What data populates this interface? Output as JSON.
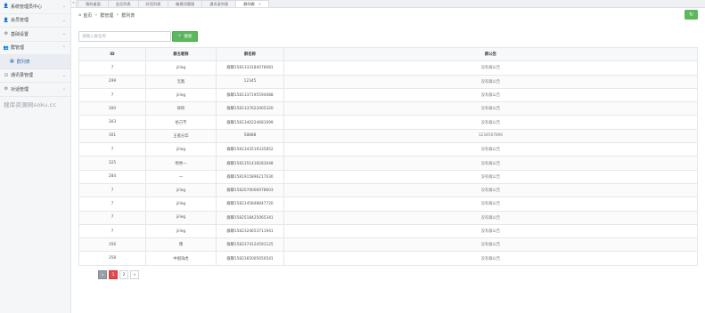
{
  "sidebar": {
    "items": [
      {
        "icon": "user-icon",
        "glyph": "👤",
        "label": "系统管理员中心",
        "chev": "⌄"
      },
      {
        "icon": "user-icon",
        "glyph": "👤",
        "label": "会员管理",
        "chev": "⌄"
      },
      {
        "icon": "gear-icon",
        "glyph": "⚙",
        "label": "基础设置",
        "chev": "⌄"
      },
      {
        "icon": "group-icon",
        "glyph": "👥",
        "label": "群管理",
        "chev": "⌃"
      }
    ],
    "active_sub": {
      "glyph": "▦",
      "label": "群列表"
    },
    "items_after": [
      {
        "icon": "checkbox-icon",
        "glyph": "☑",
        "label": "通讯录管理",
        "chev": "⌄"
      },
      {
        "icon": "gear-icon",
        "glyph": "⚙",
        "label": "对话管理",
        "chev": "⌄"
      }
    ],
    "watermark": "搜库资源网soku.cc"
  },
  "tabs": [
    {
      "label": "我的桌面",
      "active": false
    },
    {
      "label": "会员列表",
      "active": false
    },
    {
      "label": "好话列表",
      "active": false
    },
    {
      "label": "敏感词管理",
      "active": false
    },
    {
      "label": "通讯录列表",
      "active": false
    },
    {
      "label": "群列表",
      "active": true,
      "close": "×"
    }
  ],
  "tab_arrows": {
    "left": "«",
    "right": "»"
  },
  "breadcrumb": {
    "home": "首页",
    "sep": "»",
    "level1": "群管理",
    "level2": "群列表"
  },
  "refresh_glyph": "↻",
  "search": {
    "placeholder": "请输入群名称",
    "value": "",
    "button_label": "搜索",
    "button_glyph": "🔍"
  },
  "table": {
    "columns": [
      "ID",
      "群主昵称",
      "群名称",
      "群公告"
    ],
    "rows": [
      [
        "7",
        "jiileg",
        "群聊1581333184078081",
        "没有群公告"
      ],
      [
        "299",
        "无敌",
        "12345",
        "没有群公告"
      ],
      [
        "7",
        "jiileg",
        "群聊1581337195594088",
        "没有群公告"
      ],
      [
        "300",
        "碎碎",
        "群聊1581337622065320",
        "没有群公告"
      ],
      [
        "303",
        "拾己不",
        "群聊1581340224681099",
        "没有群公告"
      ],
      [
        "301",
        "王者分华",
        "58888",
        "1234567890"
      ],
      [
        "7",
        "jiileg",
        "群聊1581343519335852",
        "没有群公告"
      ],
      [
        "325",
        "明秀一",
        "群聊1581351418283048",
        "没有群公告"
      ],
      [
        "284",
        "一",
        "群聊1581915896217030",
        "没有群公告"
      ],
      [
        "7",
        "jiileg",
        "群聊1582070006978603",
        "没有群公告"
      ],
      [
        "7",
        "jiileg",
        "群聊1582145848847720",
        "没有群公告"
      ],
      [
        "7",
        "jiileg",
        "群聊1582518425065341",
        "没有群公告"
      ],
      [
        "7",
        "jiileg",
        "群聊1582324653711941",
        "没有群公告"
      ],
      [
        "356",
        "噗",
        "群聊1582374124591125",
        "没有群公告"
      ],
      [
        "358",
        "中国海虎",
        "群聊1582365005050541",
        "没有群公告"
      ]
    ]
  },
  "pagination": {
    "prev": "«",
    "pages": [
      "1",
      "2"
    ],
    "current": "1",
    "next": "»"
  },
  "colors": {
    "accent_green": "#5cb85c",
    "current_page": "#e34a4a",
    "active_link": "#3a6bb5"
  }
}
